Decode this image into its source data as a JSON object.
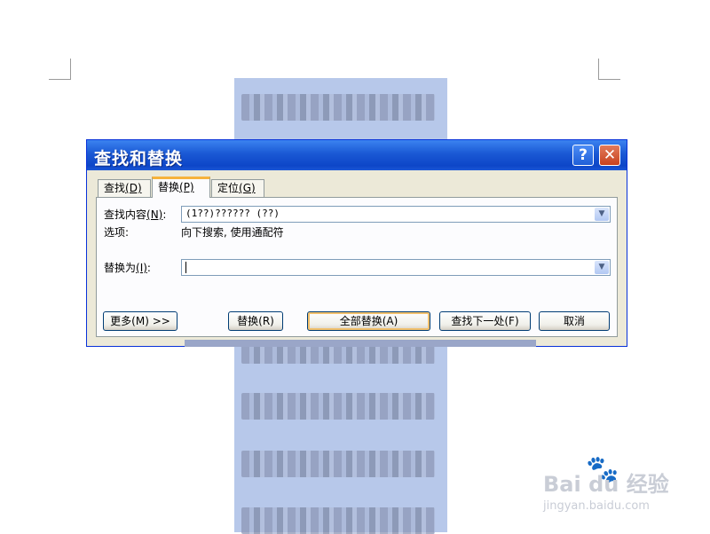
{
  "dialog": {
    "title": "查找和替换",
    "help_symbol": "?",
    "close_symbol": "✕",
    "tabs": [
      {
        "label": "查找",
        "hotkey": "(D)"
      },
      {
        "label": "替换",
        "hotkey": "(P)"
      },
      {
        "label": "定位",
        "hotkey": "(G)"
      }
    ],
    "find": {
      "label": "查找内容",
      "hotkey": "(N)",
      "suffix": ":",
      "value": "(1??)?????? (??)"
    },
    "options": {
      "label": "选项:",
      "value": "向下搜索, 使用通配符"
    },
    "replace": {
      "label": "替换为",
      "hotkey": "(I)",
      "suffix": ":",
      "value": ""
    },
    "buttons": {
      "more": "更多(M) >>",
      "replace": "替换(R)",
      "replace_all": "全部替换(A)",
      "find_next": "查找下一处(F)",
      "cancel": "取消"
    }
  },
  "watermark": {
    "brand": "Bai du 经验",
    "url": "jingyan.baidu.com"
  }
}
